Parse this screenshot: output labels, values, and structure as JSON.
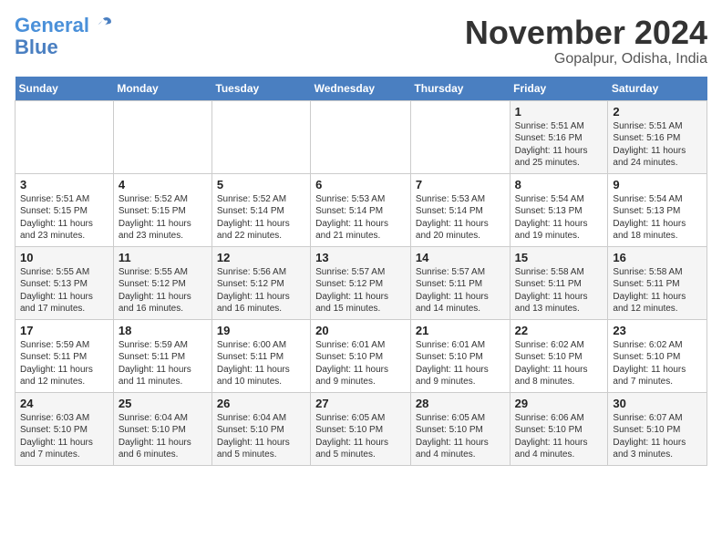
{
  "header": {
    "logo_line1": "General",
    "logo_line2": "Blue",
    "month": "November 2024",
    "location": "Gopalpur, Odisha, India"
  },
  "weekdays": [
    "Sunday",
    "Monday",
    "Tuesday",
    "Wednesday",
    "Thursday",
    "Friday",
    "Saturday"
  ],
  "weeks": [
    [
      {
        "day": "",
        "info": ""
      },
      {
        "day": "",
        "info": ""
      },
      {
        "day": "",
        "info": ""
      },
      {
        "day": "",
        "info": ""
      },
      {
        "day": "",
        "info": ""
      },
      {
        "day": "1",
        "info": "Sunrise: 5:51 AM\nSunset: 5:16 PM\nDaylight: 11 hours\nand 25 minutes."
      },
      {
        "day": "2",
        "info": "Sunrise: 5:51 AM\nSunset: 5:16 PM\nDaylight: 11 hours\nand 24 minutes."
      }
    ],
    [
      {
        "day": "3",
        "info": "Sunrise: 5:51 AM\nSunset: 5:15 PM\nDaylight: 11 hours\nand 23 minutes."
      },
      {
        "day": "4",
        "info": "Sunrise: 5:52 AM\nSunset: 5:15 PM\nDaylight: 11 hours\nand 23 minutes."
      },
      {
        "day": "5",
        "info": "Sunrise: 5:52 AM\nSunset: 5:14 PM\nDaylight: 11 hours\nand 22 minutes."
      },
      {
        "day": "6",
        "info": "Sunrise: 5:53 AM\nSunset: 5:14 PM\nDaylight: 11 hours\nand 21 minutes."
      },
      {
        "day": "7",
        "info": "Sunrise: 5:53 AM\nSunset: 5:14 PM\nDaylight: 11 hours\nand 20 minutes."
      },
      {
        "day": "8",
        "info": "Sunrise: 5:54 AM\nSunset: 5:13 PM\nDaylight: 11 hours\nand 19 minutes."
      },
      {
        "day": "9",
        "info": "Sunrise: 5:54 AM\nSunset: 5:13 PM\nDaylight: 11 hours\nand 18 minutes."
      }
    ],
    [
      {
        "day": "10",
        "info": "Sunrise: 5:55 AM\nSunset: 5:13 PM\nDaylight: 11 hours\nand 17 minutes."
      },
      {
        "day": "11",
        "info": "Sunrise: 5:55 AM\nSunset: 5:12 PM\nDaylight: 11 hours\nand 16 minutes."
      },
      {
        "day": "12",
        "info": "Sunrise: 5:56 AM\nSunset: 5:12 PM\nDaylight: 11 hours\nand 16 minutes."
      },
      {
        "day": "13",
        "info": "Sunrise: 5:57 AM\nSunset: 5:12 PM\nDaylight: 11 hours\nand 15 minutes."
      },
      {
        "day": "14",
        "info": "Sunrise: 5:57 AM\nSunset: 5:11 PM\nDaylight: 11 hours\nand 14 minutes."
      },
      {
        "day": "15",
        "info": "Sunrise: 5:58 AM\nSunset: 5:11 PM\nDaylight: 11 hours\nand 13 minutes."
      },
      {
        "day": "16",
        "info": "Sunrise: 5:58 AM\nSunset: 5:11 PM\nDaylight: 11 hours\nand 12 minutes."
      }
    ],
    [
      {
        "day": "17",
        "info": "Sunrise: 5:59 AM\nSunset: 5:11 PM\nDaylight: 11 hours\nand 12 minutes."
      },
      {
        "day": "18",
        "info": "Sunrise: 5:59 AM\nSunset: 5:11 PM\nDaylight: 11 hours\nand 11 minutes."
      },
      {
        "day": "19",
        "info": "Sunrise: 6:00 AM\nSunset: 5:11 PM\nDaylight: 11 hours\nand 10 minutes."
      },
      {
        "day": "20",
        "info": "Sunrise: 6:01 AM\nSunset: 5:10 PM\nDaylight: 11 hours\nand 9 minutes."
      },
      {
        "day": "21",
        "info": "Sunrise: 6:01 AM\nSunset: 5:10 PM\nDaylight: 11 hours\nand 9 minutes."
      },
      {
        "day": "22",
        "info": "Sunrise: 6:02 AM\nSunset: 5:10 PM\nDaylight: 11 hours\nand 8 minutes."
      },
      {
        "day": "23",
        "info": "Sunrise: 6:02 AM\nSunset: 5:10 PM\nDaylight: 11 hours\nand 7 minutes."
      }
    ],
    [
      {
        "day": "24",
        "info": "Sunrise: 6:03 AM\nSunset: 5:10 PM\nDaylight: 11 hours\nand 7 minutes."
      },
      {
        "day": "25",
        "info": "Sunrise: 6:04 AM\nSunset: 5:10 PM\nDaylight: 11 hours\nand 6 minutes."
      },
      {
        "day": "26",
        "info": "Sunrise: 6:04 AM\nSunset: 5:10 PM\nDaylight: 11 hours\nand 5 minutes."
      },
      {
        "day": "27",
        "info": "Sunrise: 6:05 AM\nSunset: 5:10 PM\nDaylight: 11 hours\nand 5 minutes."
      },
      {
        "day": "28",
        "info": "Sunrise: 6:05 AM\nSunset: 5:10 PM\nDaylight: 11 hours\nand 4 minutes."
      },
      {
        "day": "29",
        "info": "Sunrise: 6:06 AM\nSunset: 5:10 PM\nDaylight: 11 hours\nand 4 minutes."
      },
      {
        "day": "30",
        "info": "Sunrise: 6:07 AM\nSunset: 5:10 PM\nDaylight: 11 hours\nand 3 minutes."
      }
    ]
  ]
}
